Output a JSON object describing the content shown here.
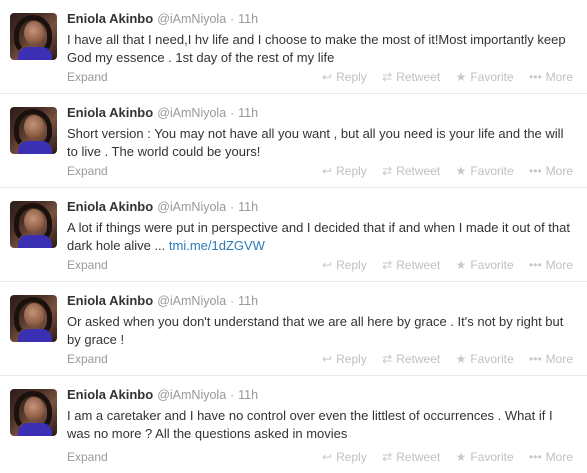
{
  "tweets": [
    {
      "name": "Eniola Akinbo",
      "handle": "@iAmNiyola",
      "time": "11h",
      "text": "I have all that I need,I hv life and I choose to make the most of it!Most importantly keep God my essence .  1st day of the rest of my life",
      "link": "",
      "expand": "Expand"
    },
    {
      "name": "Eniola Akinbo",
      "handle": "@iAmNiyola",
      "time": "11h",
      "text": "Short version : You may not have all you want , but all you need is your life and the will to live . The world could be yours!",
      "link": "",
      "expand": "Expand"
    },
    {
      "name": "Eniola Akinbo",
      "handle": "@iAmNiyola",
      "time": "11h",
      "text": "A lot if things were put in perspective and I decided that if and when I made it out of that dark hole alive ... ",
      "link": "tmi.me/1dZGVW",
      "expand": "Expand"
    },
    {
      "name": "Eniola Akinbo",
      "handle": "@iAmNiyola",
      "time": "11h",
      "text": "Or asked when you don't understand that we are all here by grace . It's not by right but by grace !",
      "link": "",
      "expand": "Expand"
    },
    {
      "name": "Eniola Akinbo",
      "handle": "@iAmNiyola",
      "time": "11h",
      "text": "I  am a caretaker and I have no control over even the littlest of occurrences . What if I was no more ?  All the questions asked in movies",
      "link": "",
      "expand": "Expand"
    }
  ],
  "actions": {
    "reply": "Reply",
    "retweet": "Retweet",
    "favorite": "Favorite",
    "more": "More"
  },
  "separator": "·",
  "icons": {
    "reply": "reply-arrow-icon",
    "retweet": "retweet-icon",
    "favorite": "star-icon",
    "more": "ellipsis-icon"
  },
  "colors": {
    "link": "#2b7bb9",
    "muted": "#999999",
    "action": "#c0c0c0"
  }
}
